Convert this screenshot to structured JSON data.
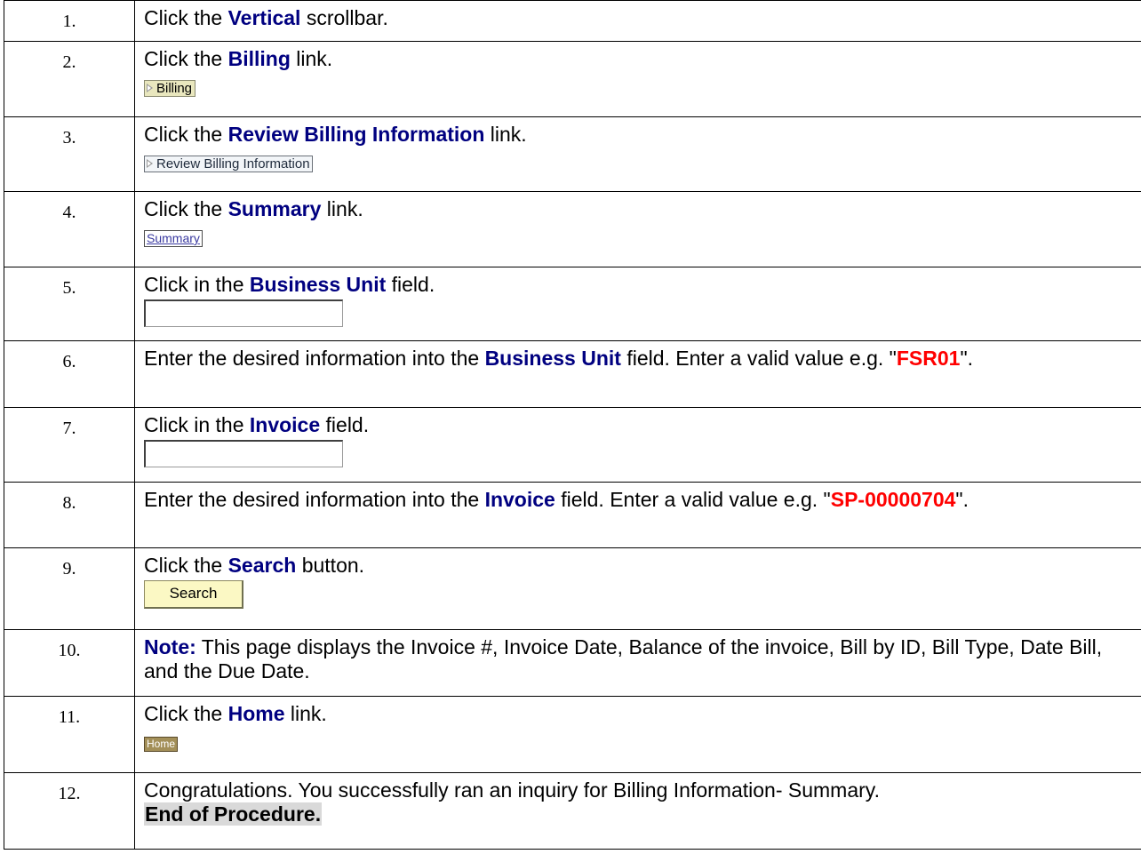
{
  "steps": [
    {
      "num": "1.",
      "pre": "Click the ",
      "bold": "Vertical",
      "post": " scrollbar."
    },
    {
      "num": "2.",
      "pre": "Click the ",
      "bold": "Billing",
      "post": " link.",
      "shot": "Billing"
    },
    {
      "num": "3.",
      "pre": "Click the ",
      "bold": "Review Billing Information",
      "post": " link.",
      "shot": "Review Billing Information"
    },
    {
      "num": "4.",
      "pre": "Click the ",
      "bold": "Summary",
      "post": " link.",
      "shot": "Summary"
    },
    {
      "num": "5.",
      "pre": "Click in the ",
      "bold": "Business Unit",
      "post": " field."
    },
    {
      "num": "6.",
      "pre": "Enter the desired information into the ",
      "bold": "Business Unit",
      "post": " field. Enter a valid value e.g. \"",
      "value": "FSR01",
      "tail": "\"."
    },
    {
      "num": "7.",
      "pre": "Click in the ",
      "bold": "Invoice",
      "post": " field."
    },
    {
      "num": "8.",
      "pre": "Enter the desired information into the ",
      "bold": "Invoice",
      "post": " field. Enter a valid value e.g. \"",
      "value": "SP-00000704",
      "tail": "\"."
    },
    {
      "num": "9.",
      "pre": "Click the ",
      "bold": "Search",
      "post": " button.",
      "shot": "Search"
    },
    {
      "num": "10.",
      "bold": "Note:",
      "post": " This page displays the Invoice #, Invoice Date, Balance of the invoice, Bill by ID, Bill Type, Date Bill, and the Due Date."
    },
    {
      "num": "11.",
      "pre": "Click the ",
      "bold": "Home",
      "post": " link.",
      "shot": "Home"
    },
    {
      "num": "12.",
      "pre": "Congratulations. You successfully ran an inquiry for Billing Information- Summary.",
      "end": "End of Procedure."
    }
  ],
  "colors": {
    "bold_text": "#000080",
    "value_text": "#ff0000",
    "end_highlight": "#d9d9d9"
  }
}
